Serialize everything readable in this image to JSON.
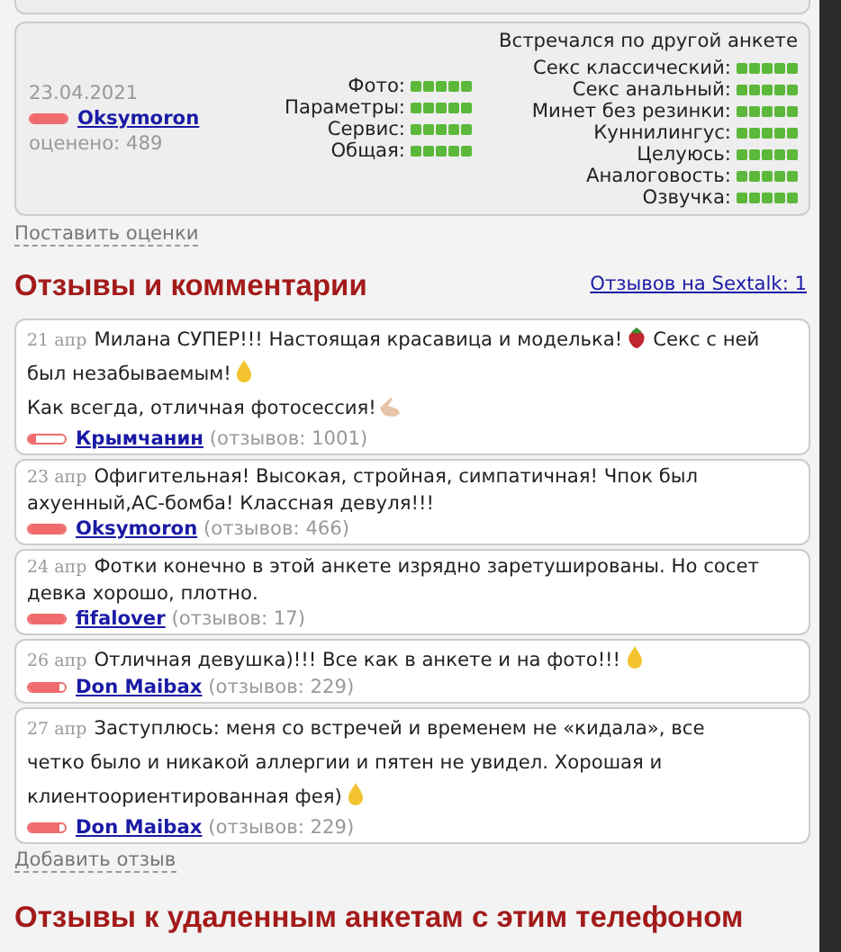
{
  "rating_card": {
    "date": "23.04.2021",
    "user": {
      "name": "Oksymoron",
      "level": 1
    },
    "rated": "оценено: 489",
    "main_scores": [
      {
        "label": "Фото:",
        "stars": 5
      },
      {
        "label": "Параметры:",
        "stars": 5
      },
      {
        "label": "Сервис:",
        "stars": 5
      },
      {
        "label": "Общая:",
        "stars": 5
      }
    ],
    "note": "Встречался по другой анкете",
    "service_scores": [
      {
        "label": "Секс классический:",
        "stars": 5
      },
      {
        "label": "Секс анальный:",
        "stars": 5
      },
      {
        "label": "Минет без резинки:",
        "stars": 5
      },
      {
        "label": "Куннилингус:",
        "stars": 5
      },
      {
        "label": "Целуюсь:",
        "stars": 5
      },
      {
        "label": "Аналоговость:",
        "stars": 5
      },
      {
        "label": "Озвучка:",
        "stars": 5
      }
    ]
  },
  "rate_link": "Поставить оценки",
  "reviews_heading": "Отзывы и комментарии",
  "sextalk_link": "Отзывов на Sextalk: 1",
  "comments": [
    {
      "date": "21 апр",
      "lines": [
        [
          {
            "kind": "text",
            "text": "Милана СУПЕР!!! Настоящая красавица и моделька!"
          },
          {
            "kind": "strawberry"
          },
          {
            "kind": "text",
            "text": "Секс с ней"
          }
        ],
        [
          {
            "kind": "text",
            "text": "был незабываемым!"
          },
          {
            "kind": "flame"
          }
        ],
        [
          {
            "kind": "text",
            "text": "Как всегда, отличная фотосессия!"
          },
          {
            "kind": "hand"
          }
        ]
      ],
      "user": {
        "name": "Крымчанин",
        "level": 0.2
      },
      "count": "(отзывов: 1001)"
    },
    {
      "date": "23 апр",
      "lines": [
        [
          {
            "kind": "text",
            "text": "Офигительная! Высокая, стройная, симпатичная! Чпок был"
          }
        ],
        [
          {
            "kind": "text",
            "text": "ахуенный,АС-бомба! Классная девуля!!!"
          }
        ]
      ],
      "user": {
        "name": "Oksymoron",
        "level": 1
      },
      "count": "(отзывов: 466)"
    },
    {
      "date": "24 апр",
      "lines": [
        [
          {
            "kind": "text",
            "text": "Фотки конечно в этой анкете изрядно заретушированы. Но сосет"
          }
        ],
        [
          {
            "kind": "text",
            "text": "девка хорошо, плотно."
          }
        ]
      ],
      "user": {
        "name": "fifalover",
        "level": 1
      },
      "count": "(отзывов: 17)"
    },
    {
      "date": "26 апр",
      "lines": [
        [
          {
            "kind": "text",
            "text": "Отличная девушка)!!! Все как в анкете и на фото!!!"
          },
          {
            "kind": "flame"
          }
        ]
      ],
      "user": {
        "name": "Don Maibax",
        "level": 0.85
      },
      "count": "(отзывов: 229)"
    },
    {
      "date": "27 апр",
      "lines": [
        [
          {
            "kind": "text",
            "text": "Заступлюсь: меня со встречей и временем не «кидала», все"
          }
        ],
        [
          {
            "kind": "text",
            "text": "четко было и никакой аллергии и пятен не увидел. Хорошая и"
          }
        ],
        [
          {
            "kind": "text",
            "text": "клиентоориентированная фея)"
          },
          {
            "kind": "flame"
          }
        ]
      ],
      "user": {
        "name": "Don Maibax",
        "level": 0.85
      },
      "count": "(отзывов: 229)"
    }
  ],
  "add_link": "Добавить отзыв",
  "deleted_heading": "Отзывы к удаленным анкетам с этим телефоном"
}
